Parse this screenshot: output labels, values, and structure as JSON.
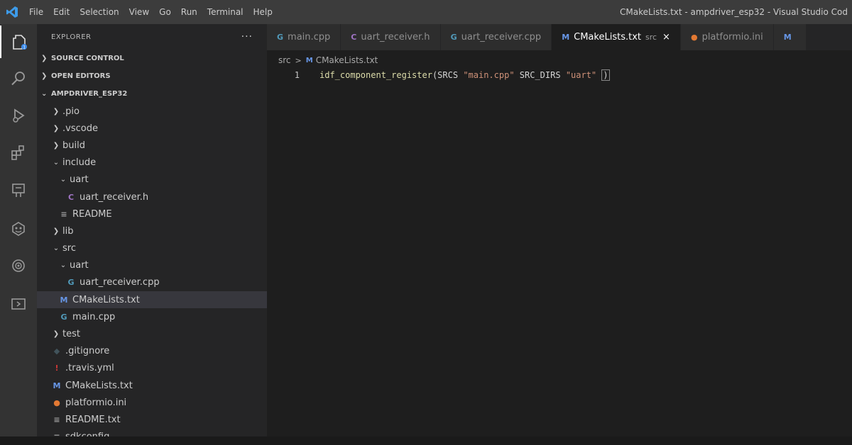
{
  "titlebar": {
    "menu": [
      "File",
      "Edit",
      "Selection",
      "View",
      "Go",
      "Run",
      "Terminal",
      "Help"
    ],
    "window_title": "CMakeLists.txt - ampdriver_esp32 - Visual Studio Cod"
  },
  "activitybar": {
    "icons": [
      "explorer-icon",
      "search-icon",
      "run-debug-icon",
      "extensions-icon",
      "test-icon",
      "platformio-icon",
      "remote-icon",
      "remote-explorer-icon"
    ]
  },
  "sidebar": {
    "title": "EXPLORER",
    "more": "···",
    "sections": {
      "source_control": "SOURCE CONTROL",
      "open_editors": "OPEN EDITORS",
      "project": "AMPDRIVER_ESP32"
    },
    "tree": [
      {
        "label": ".pio",
        "kind": "folder",
        "state": "closed",
        "depth": 0
      },
      {
        "label": ".vscode",
        "kind": "folder",
        "state": "closed",
        "depth": 0
      },
      {
        "label": "build",
        "kind": "folder",
        "state": "closed",
        "depth": 0
      },
      {
        "label": "include",
        "kind": "folder",
        "state": "open",
        "depth": 0
      },
      {
        "label": "uart",
        "kind": "folder",
        "state": "open",
        "depth": 1
      },
      {
        "label": "uart_receiver.h",
        "kind": "file",
        "icon": "C",
        "icon_color": "#a074c4",
        "depth": 2
      },
      {
        "label": "README",
        "kind": "file",
        "icon": "≡",
        "icon_color": "#9e9e9e",
        "depth": 1
      },
      {
        "label": "lib",
        "kind": "folder",
        "state": "closed",
        "depth": 0
      },
      {
        "label": "src",
        "kind": "folder",
        "state": "open",
        "depth": 0
      },
      {
        "label": "uart",
        "kind": "folder",
        "state": "open",
        "depth": 1
      },
      {
        "label": "uart_receiver.cpp",
        "kind": "file",
        "icon": "G",
        "icon_color": "#519aba",
        "depth": 2
      },
      {
        "label": "CMakeLists.txt",
        "kind": "file",
        "icon": "M",
        "icon_color": "#6796e6",
        "depth": 1,
        "selected": true
      },
      {
        "label": "main.cpp",
        "kind": "file",
        "icon": "G",
        "icon_color": "#519aba",
        "depth": 1
      },
      {
        "label": "test",
        "kind": "folder",
        "state": "closed",
        "depth": 0
      },
      {
        "label": ".gitignore",
        "kind": "file",
        "icon": "◆",
        "icon_color": "#41535b",
        "depth": 0
      },
      {
        "label": ".travis.yml",
        "kind": "file",
        "icon": "!",
        "icon_color": "#cb3837",
        "depth": 0
      },
      {
        "label": "CMakeLists.txt",
        "kind": "file",
        "icon": "M",
        "icon_color": "#6796e6",
        "depth": 0
      },
      {
        "label": "platformio.ini",
        "kind": "file",
        "icon": "●",
        "icon_color": "#e37933",
        "depth": 0
      },
      {
        "label": "README.txt",
        "kind": "file",
        "icon": "≡",
        "icon_color": "#9e9e9e",
        "depth": 0
      },
      {
        "label": "sdkconfig",
        "kind": "file",
        "icon": "≡",
        "icon_color": "#9e9e9e",
        "depth": 0
      }
    ]
  },
  "tabs": [
    {
      "label": "main.cpp",
      "icon": "G",
      "icon_color": "#519aba",
      "active": false
    },
    {
      "label": "uart_receiver.h",
      "icon": "C",
      "icon_color": "#a074c4",
      "active": false
    },
    {
      "label": "uart_receiver.cpp",
      "icon": "G",
      "icon_color": "#519aba",
      "active": false
    },
    {
      "label": "CMakeLists.txt",
      "icon": "M",
      "icon_color": "#6796e6",
      "dir": "src",
      "close": "×",
      "active": true
    },
    {
      "label": "platformio.ini",
      "icon": "●",
      "icon_color": "#e37933",
      "active": false
    },
    {
      "label": "",
      "icon": "M",
      "icon_color": "#6796e6",
      "active": false
    }
  ],
  "breadcrumb": {
    "folder": "src",
    "separator": ">",
    "file_icon": "M",
    "file": "CMakeLists.txt"
  },
  "editor": {
    "line_number": "1",
    "tokens": [
      {
        "text": "idf_component_register",
        "cls": "tok-fn"
      },
      {
        "text": "(SRCS ",
        "cls": "tok-plain"
      },
      {
        "text": "\"main.cpp\"",
        "cls": "tok-str"
      },
      {
        "text": " SRC_DIRS ",
        "cls": "tok-plain"
      },
      {
        "text": "\"uart\"",
        "cls": "tok-str"
      },
      {
        "text": " ",
        "cls": "tok-plain"
      }
    ],
    "closing_bracket": ")"
  }
}
